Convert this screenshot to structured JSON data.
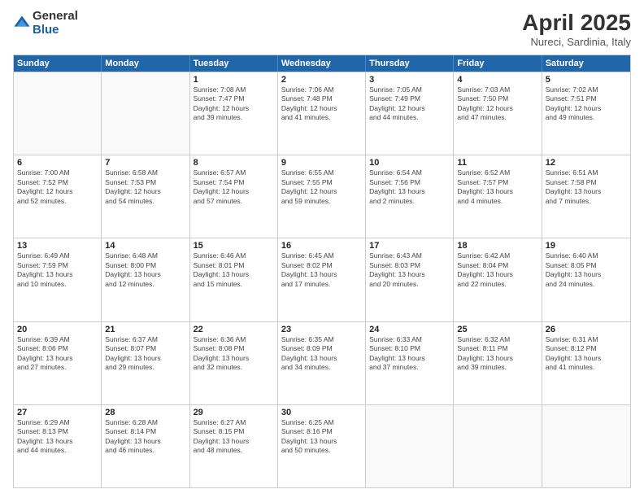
{
  "header": {
    "logo_general": "General",
    "logo_blue": "Blue",
    "title": "April 2025",
    "subtitle": "Nureci, Sardinia, Italy"
  },
  "days_of_week": [
    "Sunday",
    "Monday",
    "Tuesday",
    "Wednesday",
    "Thursday",
    "Friday",
    "Saturday"
  ],
  "weeks": [
    [
      {
        "day": "",
        "info": ""
      },
      {
        "day": "",
        "info": ""
      },
      {
        "day": "1",
        "info": "Sunrise: 7:08 AM\nSunset: 7:47 PM\nDaylight: 12 hours\nand 39 minutes."
      },
      {
        "day": "2",
        "info": "Sunrise: 7:06 AM\nSunset: 7:48 PM\nDaylight: 12 hours\nand 41 minutes."
      },
      {
        "day": "3",
        "info": "Sunrise: 7:05 AM\nSunset: 7:49 PM\nDaylight: 12 hours\nand 44 minutes."
      },
      {
        "day": "4",
        "info": "Sunrise: 7:03 AM\nSunset: 7:50 PM\nDaylight: 12 hours\nand 47 minutes."
      },
      {
        "day": "5",
        "info": "Sunrise: 7:02 AM\nSunset: 7:51 PM\nDaylight: 12 hours\nand 49 minutes."
      }
    ],
    [
      {
        "day": "6",
        "info": "Sunrise: 7:00 AM\nSunset: 7:52 PM\nDaylight: 12 hours\nand 52 minutes."
      },
      {
        "day": "7",
        "info": "Sunrise: 6:58 AM\nSunset: 7:53 PM\nDaylight: 12 hours\nand 54 minutes."
      },
      {
        "day": "8",
        "info": "Sunrise: 6:57 AM\nSunset: 7:54 PM\nDaylight: 12 hours\nand 57 minutes."
      },
      {
        "day": "9",
        "info": "Sunrise: 6:55 AM\nSunset: 7:55 PM\nDaylight: 12 hours\nand 59 minutes."
      },
      {
        "day": "10",
        "info": "Sunrise: 6:54 AM\nSunset: 7:56 PM\nDaylight: 13 hours\nand 2 minutes."
      },
      {
        "day": "11",
        "info": "Sunrise: 6:52 AM\nSunset: 7:57 PM\nDaylight: 13 hours\nand 4 minutes."
      },
      {
        "day": "12",
        "info": "Sunrise: 6:51 AM\nSunset: 7:58 PM\nDaylight: 13 hours\nand 7 minutes."
      }
    ],
    [
      {
        "day": "13",
        "info": "Sunrise: 6:49 AM\nSunset: 7:59 PM\nDaylight: 13 hours\nand 10 minutes."
      },
      {
        "day": "14",
        "info": "Sunrise: 6:48 AM\nSunset: 8:00 PM\nDaylight: 13 hours\nand 12 minutes."
      },
      {
        "day": "15",
        "info": "Sunrise: 6:46 AM\nSunset: 8:01 PM\nDaylight: 13 hours\nand 15 minutes."
      },
      {
        "day": "16",
        "info": "Sunrise: 6:45 AM\nSunset: 8:02 PM\nDaylight: 13 hours\nand 17 minutes."
      },
      {
        "day": "17",
        "info": "Sunrise: 6:43 AM\nSunset: 8:03 PM\nDaylight: 13 hours\nand 20 minutes."
      },
      {
        "day": "18",
        "info": "Sunrise: 6:42 AM\nSunset: 8:04 PM\nDaylight: 13 hours\nand 22 minutes."
      },
      {
        "day": "19",
        "info": "Sunrise: 6:40 AM\nSunset: 8:05 PM\nDaylight: 13 hours\nand 24 minutes."
      }
    ],
    [
      {
        "day": "20",
        "info": "Sunrise: 6:39 AM\nSunset: 8:06 PM\nDaylight: 13 hours\nand 27 minutes."
      },
      {
        "day": "21",
        "info": "Sunrise: 6:37 AM\nSunset: 8:07 PM\nDaylight: 13 hours\nand 29 minutes."
      },
      {
        "day": "22",
        "info": "Sunrise: 6:36 AM\nSunset: 8:08 PM\nDaylight: 13 hours\nand 32 minutes."
      },
      {
        "day": "23",
        "info": "Sunrise: 6:35 AM\nSunset: 8:09 PM\nDaylight: 13 hours\nand 34 minutes."
      },
      {
        "day": "24",
        "info": "Sunrise: 6:33 AM\nSunset: 8:10 PM\nDaylight: 13 hours\nand 37 minutes."
      },
      {
        "day": "25",
        "info": "Sunrise: 6:32 AM\nSunset: 8:11 PM\nDaylight: 13 hours\nand 39 minutes."
      },
      {
        "day": "26",
        "info": "Sunrise: 6:31 AM\nSunset: 8:12 PM\nDaylight: 13 hours\nand 41 minutes."
      }
    ],
    [
      {
        "day": "27",
        "info": "Sunrise: 6:29 AM\nSunset: 8:13 PM\nDaylight: 13 hours\nand 44 minutes."
      },
      {
        "day": "28",
        "info": "Sunrise: 6:28 AM\nSunset: 8:14 PM\nDaylight: 13 hours\nand 46 minutes."
      },
      {
        "day": "29",
        "info": "Sunrise: 6:27 AM\nSunset: 8:15 PM\nDaylight: 13 hours\nand 48 minutes."
      },
      {
        "day": "30",
        "info": "Sunrise: 6:25 AM\nSunset: 8:16 PM\nDaylight: 13 hours\nand 50 minutes."
      },
      {
        "day": "",
        "info": ""
      },
      {
        "day": "",
        "info": ""
      },
      {
        "day": "",
        "info": ""
      }
    ]
  ]
}
